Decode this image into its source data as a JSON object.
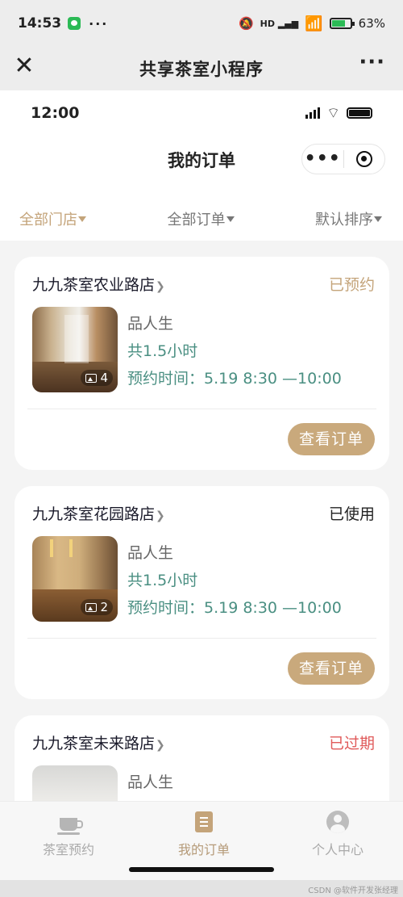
{
  "android_status": {
    "time": "14:53",
    "dots": "···",
    "hd": "HD",
    "battery": "63%"
  },
  "mp_bar": {
    "close": "✕",
    "title": "共享茶室小程序",
    "more": "···"
  },
  "ios_status": {
    "time": "12:00"
  },
  "nav": {
    "title": "我的订单",
    "capsule_more": "•••"
  },
  "filters": [
    {
      "label": "全部门店"
    },
    {
      "label": "全部订单"
    },
    {
      "label": "默认排序"
    }
  ],
  "orders": [
    {
      "store": "九九茶室农业路店",
      "status": "已预约",
      "package": "品人生",
      "duration": "共1.5小时",
      "time": "预约时间：5.19 8:30 —10:00",
      "image_count": "4",
      "button": "查看订单"
    },
    {
      "store": "九九茶室花园路店",
      "status": "已使用",
      "package": "品人生",
      "duration": "共1.5小时",
      "time": "预约时间：5.19 8:30 —10:00",
      "image_count": "2",
      "button": "查看订单"
    },
    {
      "store": "九九茶室未来路店",
      "status": "已过期",
      "package": "品人生"
    }
  ],
  "tabbar": [
    {
      "label": "茶室预约",
      "icon": "tea-cup-icon"
    },
    {
      "label": "我的订单",
      "icon": "order-doc-icon"
    },
    {
      "label": "个人中心",
      "icon": "person-icon"
    }
  ],
  "watermark": "CSDN @软件开发张经理",
  "colors": {
    "accent": "#c4a47a",
    "teal": "#4a8f82",
    "expired": "#e05a5a",
    "button": "#c9a97c"
  }
}
